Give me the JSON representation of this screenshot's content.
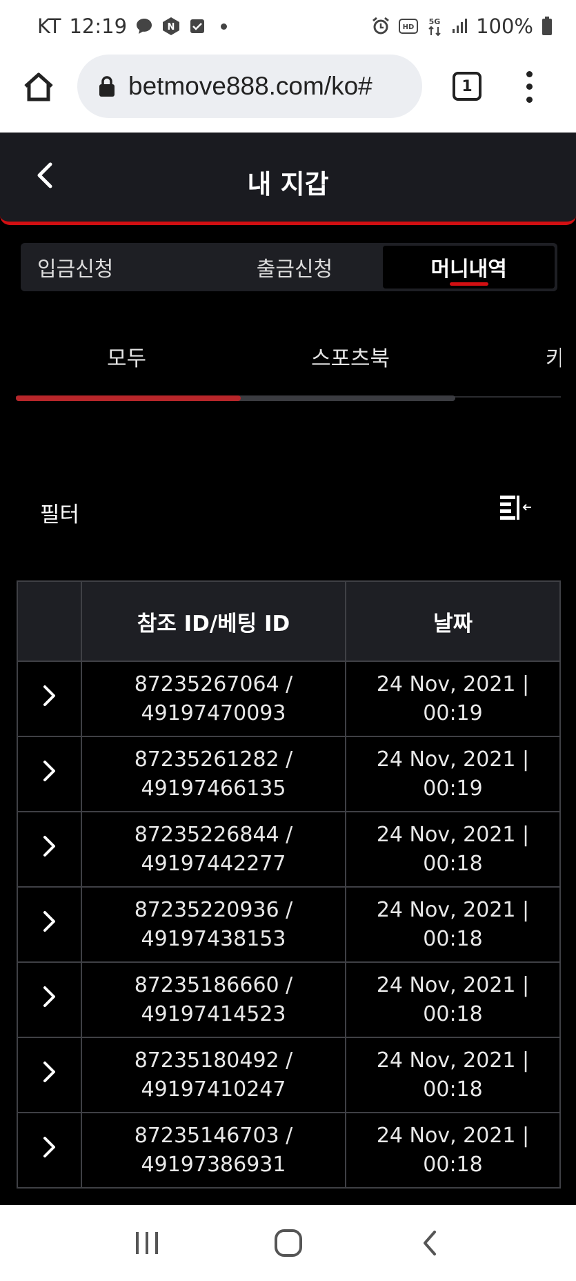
{
  "status_bar": {
    "carrier": "KT",
    "time": "12:19",
    "battery": "100%"
  },
  "browser": {
    "url": "betmove888.com/ko#",
    "tab_count": "1"
  },
  "header": {
    "title": "내 지갑"
  },
  "wallet_tabs": [
    {
      "label": "입금신청",
      "active": false
    },
    {
      "label": "출금신청",
      "active": false
    },
    {
      "label": "머니내역",
      "active": true
    }
  ],
  "sub_tabs": [
    {
      "label": "모두",
      "active": true
    },
    {
      "label": "스포츠북",
      "active": false
    },
    {
      "label": "카",
      "active": false
    }
  ],
  "filter": {
    "label": "필터"
  },
  "table": {
    "headers": [
      "",
      "참조 ID/베팅 ID",
      "날짜"
    ],
    "rows": [
      {
        "ref": "87235267064 /",
        "bet": "49197470093",
        "date": "24 Nov, 2021 |",
        "time": "00:19"
      },
      {
        "ref": "87235261282 /",
        "bet": "49197466135",
        "date": "24 Nov, 2021 |",
        "time": "00:19"
      },
      {
        "ref": "87235226844 /",
        "bet": "49197442277",
        "date": "24 Nov, 2021 |",
        "time": "00:18"
      },
      {
        "ref": "87235220936 /",
        "bet": "49197438153",
        "date": "24 Nov, 2021 |",
        "time": "00:18"
      },
      {
        "ref": "87235186660 /",
        "bet": "49197414523",
        "date": "24 Nov, 2021 |",
        "time": "00:18"
      },
      {
        "ref": "87235180492 /",
        "bet": "49197410247",
        "date": "24 Nov, 2021 |",
        "time": "00:18"
      },
      {
        "ref": "87235146703 /",
        "bet": "49197386931",
        "date": "24 Nov, 2021 |",
        "time": "00:18"
      }
    ]
  },
  "colors": {
    "accent": "#d20f12",
    "header_bg": "#1a1b20",
    "page_bg": "#000000"
  }
}
